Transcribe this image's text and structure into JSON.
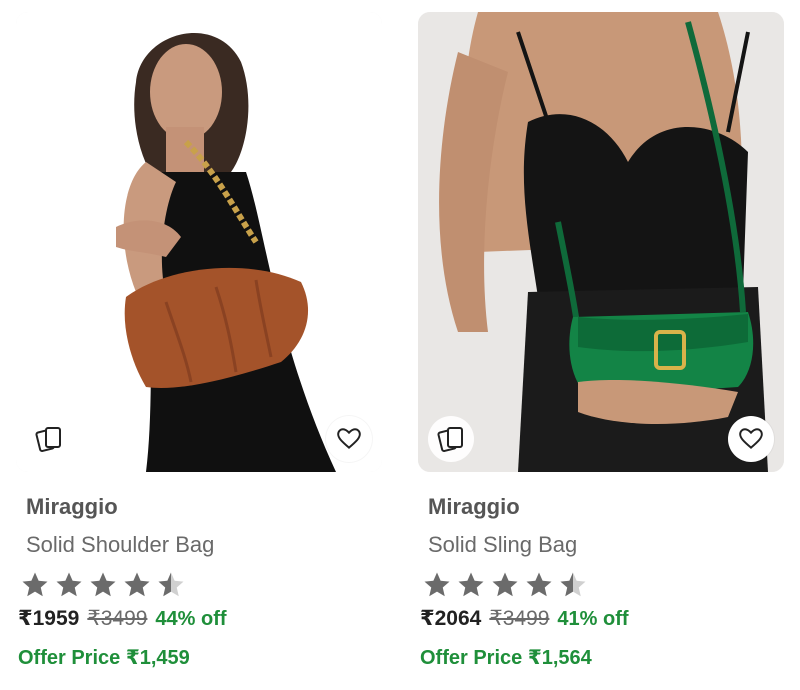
{
  "products": [
    {
      "brand": "Miraggio",
      "name": "Solid Shoulder Bag",
      "rating": 4.5,
      "price": "₹1959",
      "mrp": "₹3499",
      "discount": "44% off",
      "offer_price": "Offer Price ₹1,459",
      "icons": {
        "similar": "similar-products-icon",
        "wishlist": "heart-icon",
        "rating": "star-icon"
      }
    },
    {
      "brand": "Miraggio",
      "name": "Solid Sling Bag",
      "rating": 4.5,
      "price": "₹2064",
      "mrp": "₹3499",
      "discount": "41% off",
      "offer_price": "Offer Price ₹1,564",
      "icons": {
        "similar": "similar-products-icon",
        "wishlist": "heart-icon",
        "rating": "star-icon"
      }
    }
  ],
  "colors": {
    "brand_text": "#555555",
    "name_text": "#6a6a6a",
    "price_text": "#222222",
    "discount_green": "#1f8f3a",
    "star_gray": "#6b6b6b",
    "star_empty": "#d0d0d0"
  }
}
